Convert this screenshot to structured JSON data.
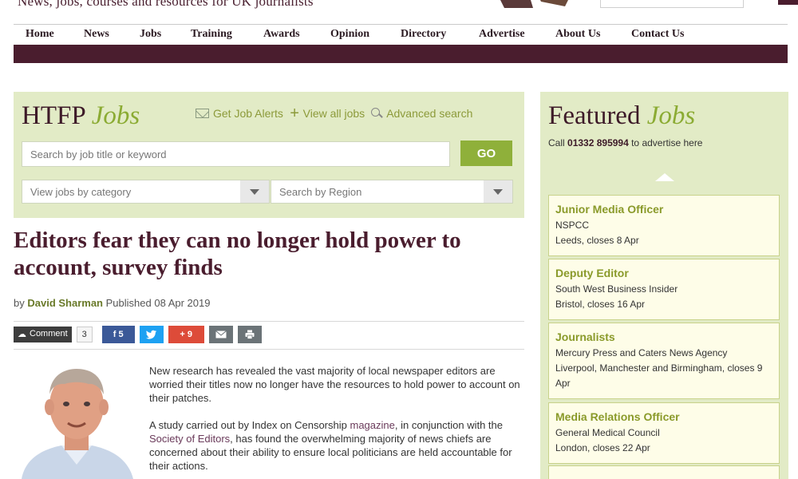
{
  "site": {
    "tagline": "News, jobs, courses and resources for UK journalists"
  },
  "nav": {
    "items": [
      "Home",
      "News",
      "Jobs",
      "Training",
      "Awards",
      "Opinion",
      "Directory",
      "Advertise",
      "About Us",
      "Contact Us"
    ]
  },
  "jobs_search": {
    "title_main": "HTFP",
    "title_italic": "Jobs",
    "links": [
      "Get Job Alerts",
      "View all jobs",
      "Advanced search"
    ],
    "keyword_placeholder": "Search by job title or keyword",
    "go_label": "GO",
    "category_select": "View jobs by category",
    "region_select": "Search by Region"
  },
  "article": {
    "headline": "Editors fear they can no longer hold power to account, survey finds",
    "by": "by",
    "author": "David Sharman",
    "published": "Published 08 Apr 2019",
    "comment_label": "Comment",
    "comment_count": "3",
    "share": {
      "facebook": "f 5",
      "twitter": "🐦",
      "gplus": "+ 9",
      "email": "✉",
      "print": "⎙"
    },
    "para1": "New research has revealed the vast majority of local newspaper editors are worried their titles now no longer have the resources to hold power to account on their patches.",
    "para2_a": "A study carried out by Index on Censorship ",
    "para2_link1": "magazine",
    "para2_b": ", in conjunction with the ",
    "para2_link2": "Society of Editors",
    "para2_c": ", has found the overwhelming majority of news chiefs are concerned about their ability to ensure local politicians are held accountable for their actions."
  },
  "featured": {
    "title_main": "Featured",
    "title_italic": "Jobs",
    "call_prefix": "Call ",
    "call_number": "01332 895994",
    "call_suffix": " to advertise here",
    "jobs": [
      {
        "title": "Junior Media Officer",
        "company": "NSPCC",
        "location": "Leeds, closes 8 Apr"
      },
      {
        "title": "Deputy Editor",
        "company": "South West Business Insider",
        "location": "Bristol, closes 16 Apr"
      },
      {
        "title": "Journalists",
        "company": "Mercury Press and Caters News Agency",
        "location": "Liverpool, Manchester and Birmingham, closes 9 Apr"
      },
      {
        "title": "Media Relations Officer",
        "company": "General Medical Council",
        "location": "London, closes 22 Apr"
      }
    ]
  },
  "colors": {
    "brand": "#4a1d2e",
    "accent": "#8fb03a",
    "panel": "#e2ebc6"
  }
}
